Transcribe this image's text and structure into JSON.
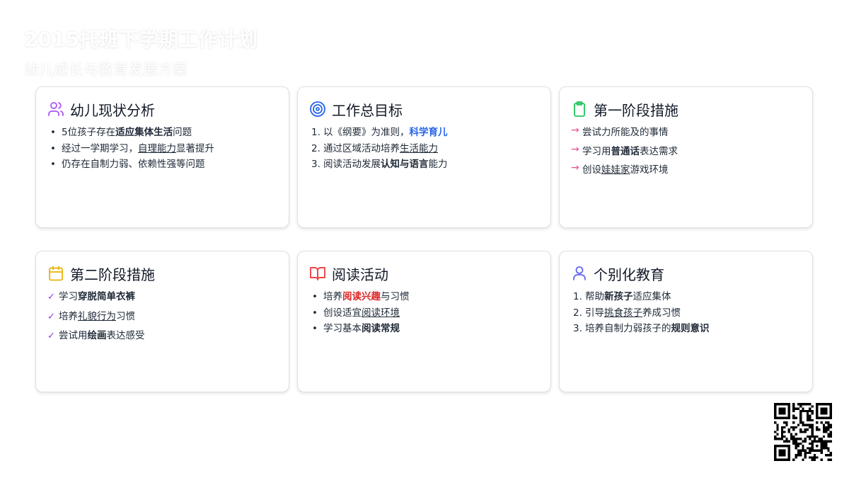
{
  "header": {
    "title": "2015托班下学期工作计划",
    "subtitle": "幼儿成长与教育发展方案"
  },
  "cards": [
    {
      "title": "幼儿现状分析",
      "icon": "users-icon",
      "accent": "#a855f7",
      "items": [
        {
          "pre": "5位孩子存在",
          "em": "适应集体生活",
          "post": "问题"
        },
        {
          "pre": "经过一学期学习，",
          "em": "自理能力",
          "post": "显著提升"
        },
        {
          "pre": "仍存在自制力弱、依赖性强等问题",
          "em": "",
          "post": ""
        }
      ]
    },
    {
      "title": "工作总目标",
      "icon": "target-icon",
      "accent": "#2563eb",
      "items": [
        {
          "num": "1.",
          "pre": "以《纲要》为准则，",
          "em": "科学育儿",
          "post": ""
        },
        {
          "num": "2.",
          "pre": "通过区域活动培养",
          "em": "生活能力",
          "post": ""
        },
        {
          "num": "3.",
          "pre": "阅读活动发展",
          "em": "认知与语言",
          "post": "能力"
        }
      ]
    },
    {
      "title": "第一阶段措施",
      "icon": "clipboard-icon",
      "accent": "#22c55e",
      "items": [
        {
          "pre": "尝试力所能及的事情",
          "em": "",
          "post": ""
        },
        {
          "pre": "学习用",
          "em": "普通话",
          "post": "表达需求"
        },
        {
          "pre": "创设",
          "em": "娃娃家",
          "post": "游戏环境"
        }
      ]
    },
    {
      "title": "第二阶段措施",
      "icon": "calendar-icon",
      "accent": "#eab308",
      "items": [
        {
          "pre": "学习",
          "em": "穿脱简单衣裤",
          "post": ""
        },
        {
          "pre": "培养",
          "em": "礼貌行为",
          "post": "习惯"
        },
        {
          "pre": "尝试用",
          "em": "绘画",
          "post": "表达感受"
        }
      ]
    },
    {
      "title": "阅读活动",
      "icon": "book-open-icon",
      "accent": "#ef4444",
      "items": [
        {
          "pre": "培养",
          "em": "阅读兴趣",
          "post": "与习惯"
        },
        {
          "pre": "创设适宜",
          "em": "阅读环境",
          "post": ""
        },
        {
          "pre": "学习基本",
          "em": "阅读常规",
          "post": ""
        }
      ]
    },
    {
      "title": "个别化教育",
      "icon": "user-icon",
      "accent": "#6366f1",
      "items": [
        {
          "num": "1.",
          "pre": "帮助",
          "em": "新孩子",
          "post": "适应集体"
        },
        {
          "num": "2.",
          "pre": "引导",
          "em": "挑食孩子",
          "post": "养成习惯"
        },
        {
          "num": "3.",
          "pre": "培养自制力弱孩子的",
          "em": "规则意识",
          "post": ""
        }
      ]
    }
  ],
  "qr": {
    "icon": "qr-code-icon"
  }
}
